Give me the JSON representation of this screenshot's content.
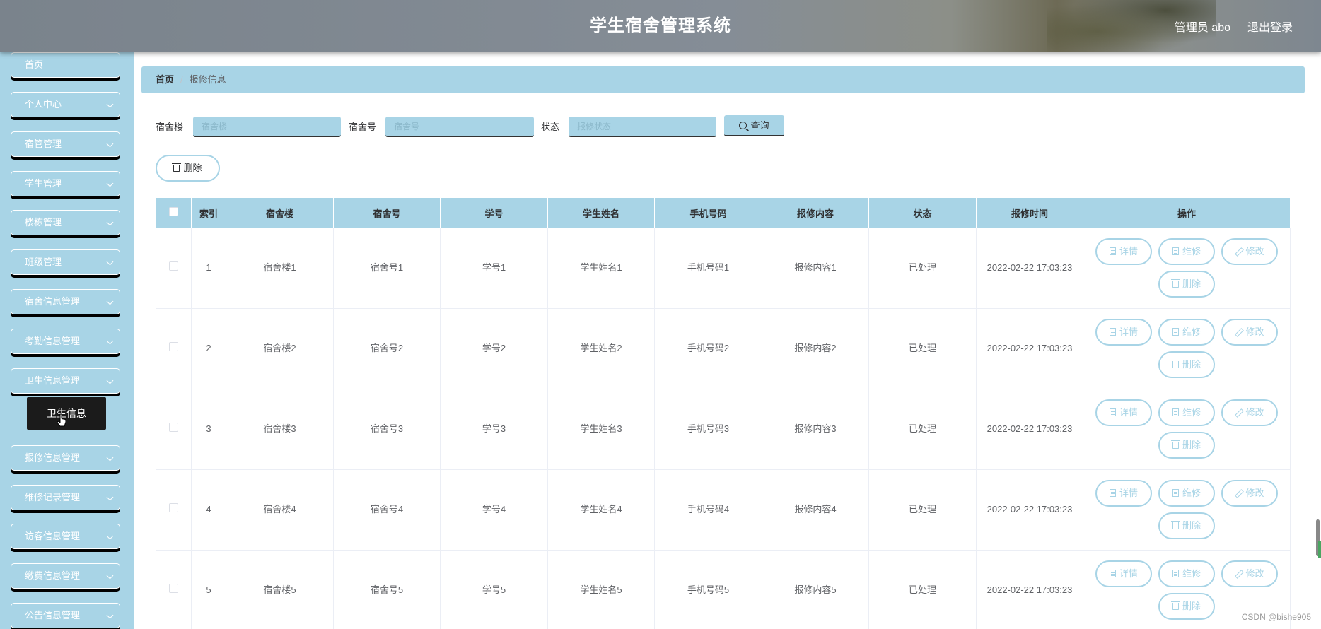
{
  "header": {
    "title": "学生宿舍管理系统",
    "admin_label": "管理员 abo",
    "logout_label": "退出登录"
  },
  "sidebar": {
    "items": [
      {
        "label": "首页",
        "has_chevron": false
      },
      {
        "label": "个人中心",
        "has_chevron": true
      },
      {
        "label": "宿管管理",
        "has_chevron": true
      },
      {
        "label": "学生管理",
        "has_chevron": true
      },
      {
        "label": "楼栋管理",
        "has_chevron": true
      },
      {
        "label": "班级管理",
        "has_chevron": true
      },
      {
        "label": "宿舍信息管理",
        "has_chevron": true
      },
      {
        "label": "考勤信息管理",
        "has_chevron": true
      },
      {
        "label": "卫生信息管理",
        "has_chevron": true
      },
      {
        "label": "报修信息管理",
        "has_chevron": true
      },
      {
        "label": "维修记录管理",
        "has_chevron": true
      },
      {
        "label": "访客信息管理",
        "has_chevron": true
      },
      {
        "label": "缴费信息管理",
        "has_chevron": true
      },
      {
        "label": "公告信息管理",
        "has_chevron": true
      }
    ],
    "submenu_label": "卫生信息"
  },
  "breadcrumb": {
    "home": "首页",
    "separator": "/",
    "current": "报修信息"
  },
  "search": {
    "building_label": "宿舍楼",
    "building_placeholder": "宿舍楼",
    "room_label": "宿舍号",
    "room_placeholder": "宿舍号",
    "status_label": "状态",
    "status_placeholder": "报修状态",
    "query_label": "查询"
  },
  "toolbar": {
    "delete_label": "删除"
  },
  "table": {
    "columns": [
      "索引",
      "宿舍楼",
      "宿舍号",
      "学号",
      "学生姓名",
      "手机号码",
      "报修内容",
      "状态",
      "报修时间",
      "操作"
    ],
    "rows": [
      {
        "index": "1",
        "building": "宿舍楼1",
        "room": "宿舍号1",
        "student_no": "学号1",
        "name": "学生姓名1",
        "phone": "手机号码1",
        "content": "报修内容1",
        "status": "已处理",
        "time": "2022-02-22 17:03:23"
      },
      {
        "index": "2",
        "building": "宿舍楼2",
        "room": "宿舍号2",
        "student_no": "学号2",
        "name": "学生姓名2",
        "phone": "手机号码2",
        "content": "报修内容2",
        "status": "已处理",
        "time": "2022-02-22 17:03:23"
      },
      {
        "index": "3",
        "building": "宿舍楼3",
        "room": "宿舍号3",
        "student_no": "学号3",
        "name": "学生姓名3",
        "phone": "手机号码3",
        "content": "报修内容3",
        "status": "已处理",
        "time": "2022-02-22 17:03:23"
      },
      {
        "index": "4",
        "building": "宿舍楼4",
        "room": "宿舍号4",
        "student_no": "学号4",
        "name": "学生姓名4",
        "phone": "手机号码4",
        "content": "报修内容4",
        "status": "已处理",
        "time": "2022-02-22 17:03:23"
      },
      {
        "index": "5",
        "building": "宿舍楼5",
        "room": "宿舍号5",
        "student_no": "学号5",
        "name": "学生姓名5",
        "phone": "手机号码5",
        "content": "报修内容5",
        "status": "已处理",
        "time": "2022-02-22 17:03:23"
      }
    ],
    "actions": {
      "detail": "详情",
      "repair": "维修",
      "edit": "修改",
      "delete": "删除"
    }
  },
  "watermark": "CSDN @bishe905",
  "colors": {
    "accent": "#a8d4e6",
    "submenu_bg": "#1b1b1b",
    "header_bg": "#858d96"
  }
}
